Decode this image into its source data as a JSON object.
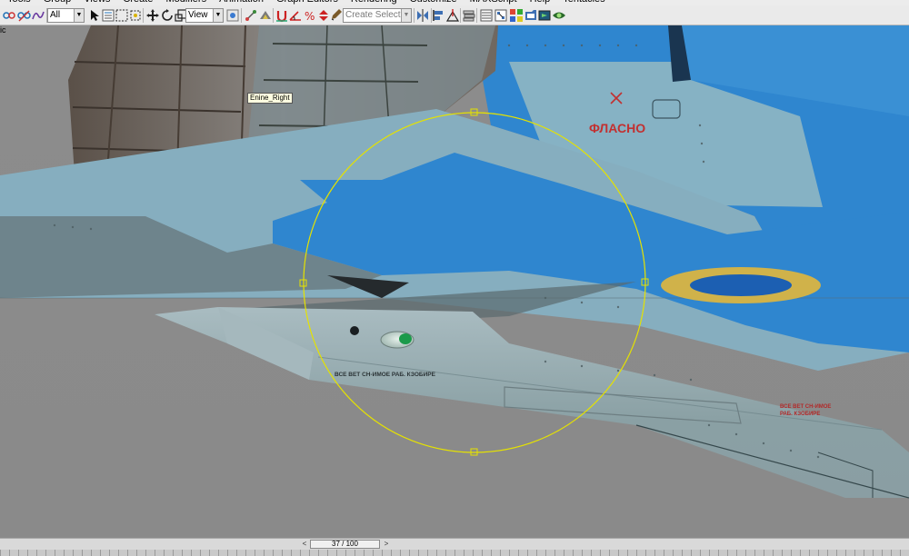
{
  "menu": {
    "items": [
      "Tools",
      "Group",
      "Views",
      "Create",
      "Modifiers",
      "Animation",
      "Graph Editors",
      "Rendering",
      "Customize",
      "MAXScript",
      "Help",
      "Tentacles"
    ]
  },
  "toolbar": {
    "selection_filter": "All",
    "reference_coordinate_system": "View",
    "named_selection_placeholder": "Create Selection Se"
  },
  "viewport": {
    "label": "ic",
    "object_tooltip": "Enine_Right",
    "texture_texts": {
      "tail_marking": "ФЛАСНО",
      "wing_stencil": "ВСЕ ВЕТ СН-ИМОЕ РАБ. КЗОБИРЕ",
      "right_stencil_line1": "ВСЕ ВЕТ СН-ИМОЕ",
      "right_stencil_line2": "РАБ. КЗОБИРЕ"
    },
    "colors": {
      "background": "#8a8a8a",
      "skin_light": "#8ab0c0",
      "camo_blue": "#2f86cf",
      "gizmo": "#e5e200",
      "roundel_ring": "#d0b24a",
      "roundel_center": "#1c5fb2"
    }
  },
  "timeline": {
    "frame_display": "37 / 100",
    "current_frame": 37,
    "total_frames": 100,
    "prev_label": "<",
    "next_label": ">"
  }
}
